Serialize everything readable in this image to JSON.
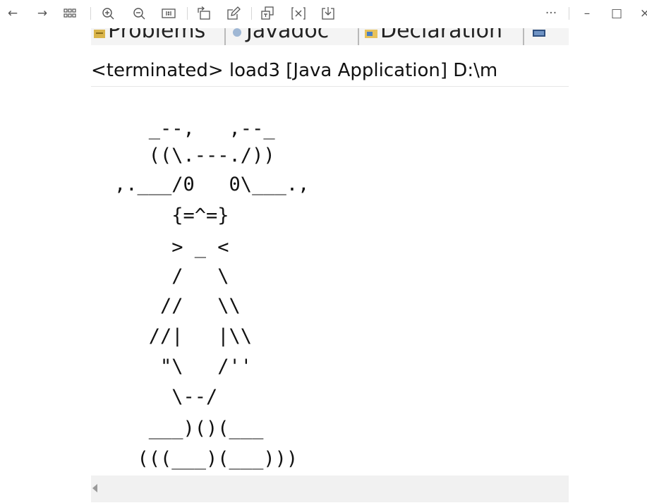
{
  "toolbar": {
    "back": "←",
    "forward": "→",
    "more": "···",
    "minimize": "–",
    "maximize": "□",
    "close": "×"
  },
  "ide": {
    "tabs": [
      "Problems",
      "Javadoc",
      "Declaration"
    ],
    "console_title": "<terminated> load3 [Java Application] D:\\m"
  },
  "console": {
    "lines": [
      "   _--,   ,--_",
      "   ((\\.---./))",
      ",.___/0   0\\___.,",
      "     {=^=}",
      "     > _ <",
      "     /   \\",
      "    //   \\\\",
      "   //|   |\\\\",
      "    \"\\   /''",
      "     \\--/",
      "   ___)()(___",
      "  (((___)(___)))"
    ]
  }
}
